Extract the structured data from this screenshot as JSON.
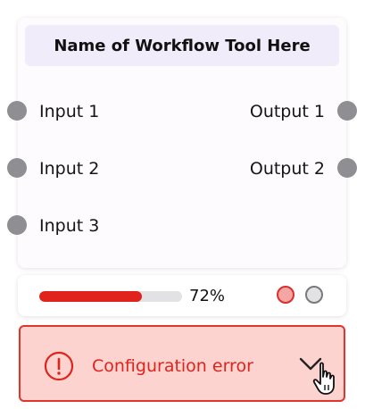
{
  "node": {
    "title": "Name of Workflow Tool Here",
    "inputs": [
      "Input 1",
      "Input 2",
      "Input 3"
    ],
    "outputs": [
      "Output 1",
      "Output 2"
    ]
  },
  "progress": {
    "value": 0.72,
    "label": "72%"
  },
  "status_dots": [
    {
      "name": "error",
      "fill": "#f6a5a5",
      "border": "#d8302a"
    },
    {
      "name": "idle",
      "fill": "#e2e2e5",
      "border": "#7a7a7a"
    }
  ],
  "error": {
    "message": "Configuration error",
    "icon": "exclamation-circle-icon",
    "toggle_icon": "chevron-down-icon"
  },
  "colors": {
    "error": "#e0231c",
    "error_bg": "#fdd3d0",
    "header_bg": "#f1ecfa",
    "port": "#8e8e93"
  }
}
